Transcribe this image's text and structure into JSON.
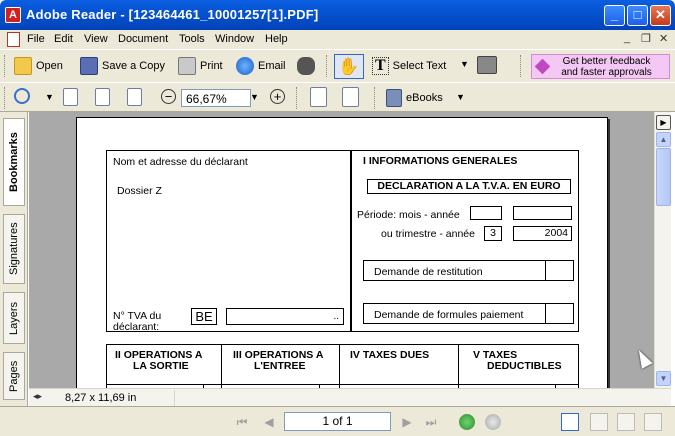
{
  "window": {
    "title": "Adobe Reader - [123464461_10001257[1].PDF]",
    "app_icon_glyph": "A",
    "controls": {
      "minimize": "_",
      "maximize": "□",
      "close": "✕"
    }
  },
  "menubar": {
    "items": [
      "File",
      "Edit",
      "View",
      "Document",
      "Tools",
      "Window",
      "Help"
    ],
    "mdi_controls": {
      "minimize": "_",
      "restore": "❐",
      "close": "✕"
    }
  },
  "toolbar1": {
    "open": "Open",
    "save_copy": "Save a Copy",
    "print": "Print",
    "email": "Email",
    "select_text": "Select Text",
    "feedback_line1": "Get better feedback",
    "feedback_line2": "and faster approvals"
  },
  "toolbar2": {
    "zoom_value": "66,67%",
    "ebooks": "eBooks"
  },
  "side_tabs": [
    "Bookmarks",
    "Signatures",
    "Layers",
    "Pages"
  ],
  "document": {
    "declarant_label": "Nom et adresse du déclarant",
    "dossier": "Dossier Z",
    "tva_label_line1": "N° TVA du",
    "tva_label_line2": "déclarant:",
    "tva_country": "BE",
    "tva_dots": "..",
    "section_i": "I   INFORMATIONS GENERALES",
    "declaration_title": "DECLARATION A LA T.V.A. EN EURO",
    "periode_label": "Période: mois - année",
    "trimestre_label": "ou trimestre - année",
    "trimestre_value": "3",
    "annee_value": "2004",
    "restitution": "Demande de restitution",
    "formules": "Demande de formules paiement",
    "col_ii_line1": "II    OPERATIONS A",
    "col_ii_line2": "LA SORTIE",
    "col_iii_line1": "III    OPERATIONS A",
    "col_iii_line2": "L'ENTREE",
    "col_iv": "IV  TAXES DUES",
    "col_v_line1": "V   TAXES",
    "col_v_line2": "DEDUCTIBLES"
  },
  "status": {
    "page_size": "8,27 x 11,69 in"
  },
  "navigation": {
    "page_indicator": "1 of 1"
  }
}
